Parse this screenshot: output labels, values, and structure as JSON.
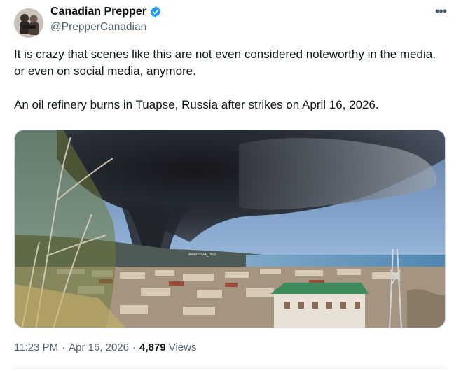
{
  "author": {
    "name": "Canadian Prepper",
    "handle": "@PrepperCanadian",
    "verified_color": "#1d9bf0"
  },
  "icons": {
    "verified": "verified-badge-icon",
    "more": "more-options-icon"
  },
  "tweet": {
    "paragraph1": "It is crazy that scenes like this are not even considered noteworthy in the media, or even on social media, anymore.",
    "paragraph2": "An oil refinery burns in Tuapse, Russia after strikes on April 16, 2026."
  },
  "media": {
    "watermark": "exilenova_plus"
  },
  "meta": {
    "time": "11:23 PM",
    "date": "Apr 16, 2026",
    "views_count": "4,879",
    "views_label": "Views"
  }
}
